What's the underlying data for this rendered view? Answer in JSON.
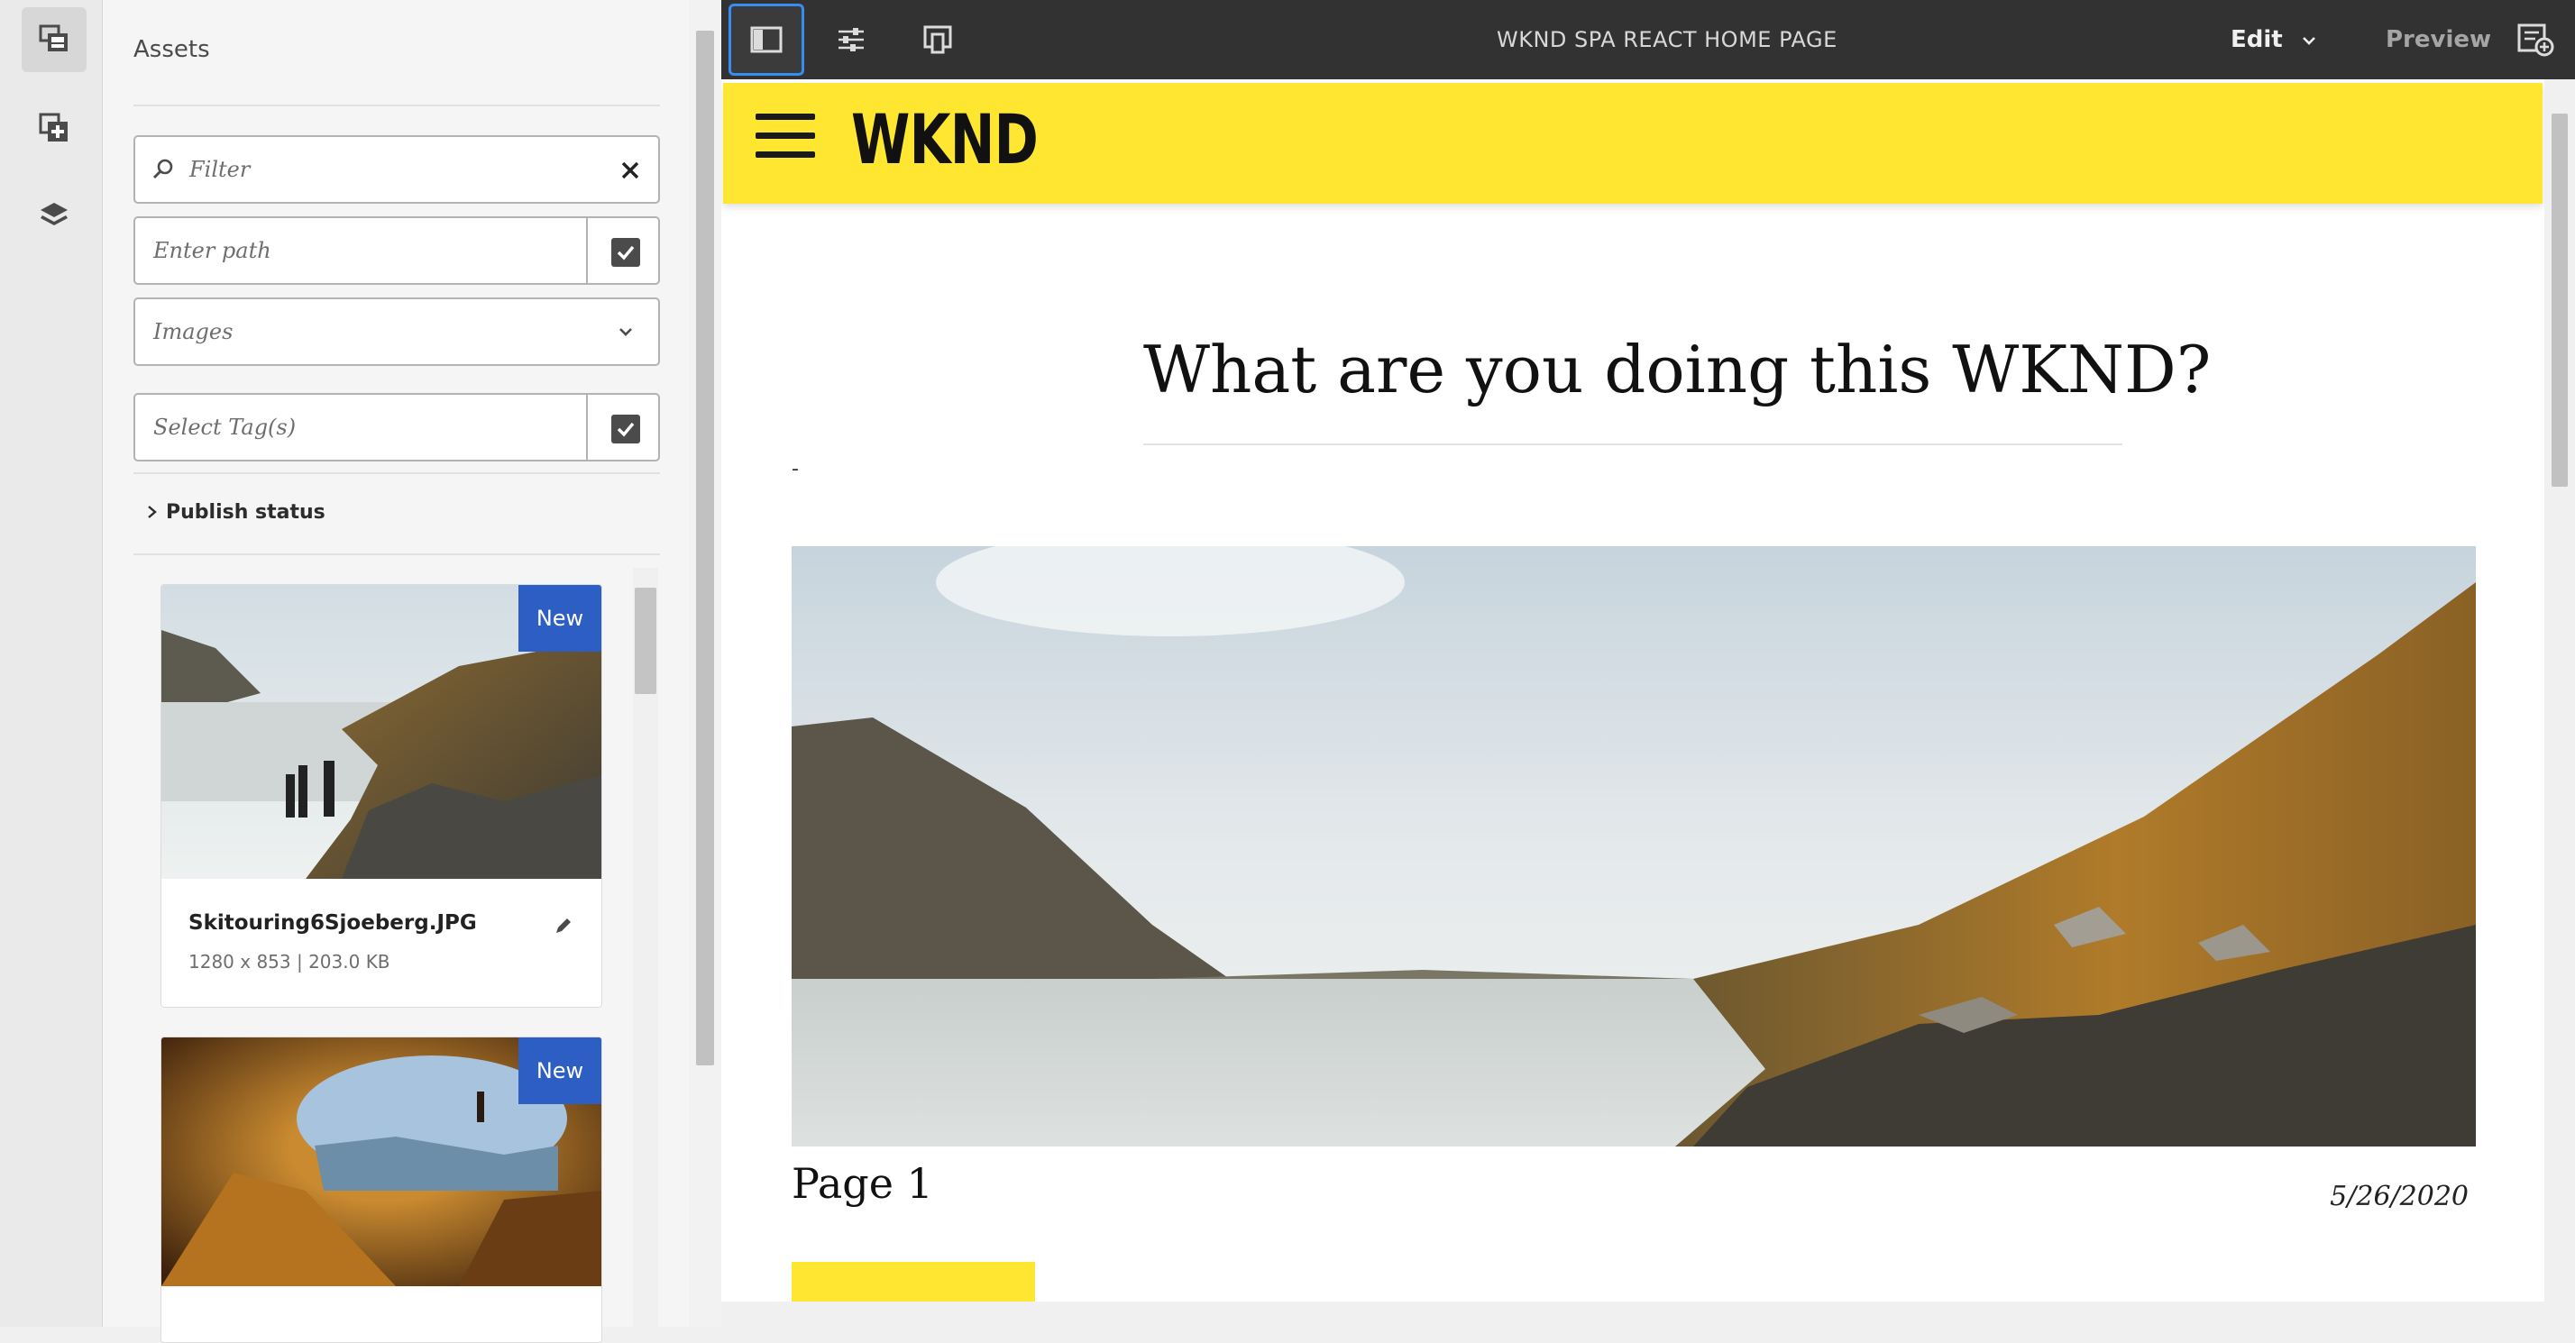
{
  "rail": {
    "items": [
      {
        "icon": "assets-icon",
        "active": true
      },
      {
        "icon": "components-icon",
        "active": false
      },
      {
        "icon": "content-tree-icon",
        "active": false
      }
    ]
  },
  "panel": {
    "title": "Assets",
    "filter_placeholder": "Filter",
    "path_placeholder": "Enter path",
    "type_selected": "Images",
    "tags_placeholder": "Select Tag(s)",
    "publish_status_label": "Publish status",
    "assets": [
      {
        "name": "Skitouring6Sjoeberg.JPG",
        "meta": "1280 x 853 | 203.0 KB",
        "badge": "New"
      },
      {
        "name": "",
        "meta": "",
        "badge": "New"
      }
    ]
  },
  "topbar": {
    "title": "WKND SPA REACT HOME PAGE",
    "mode_label": "Edit",
    "preview_label": "Preview",
    "accent": "#378ef0"
  },
  "page": {
    "logo": "WKND",
    "headline": "What are you doing this WKND?",
    "dash": "-",
    "teaser_title": "Page 1",
    "teaser_date": "5/26/2020",
    "brand_color": "#ffe631"
  }
}
